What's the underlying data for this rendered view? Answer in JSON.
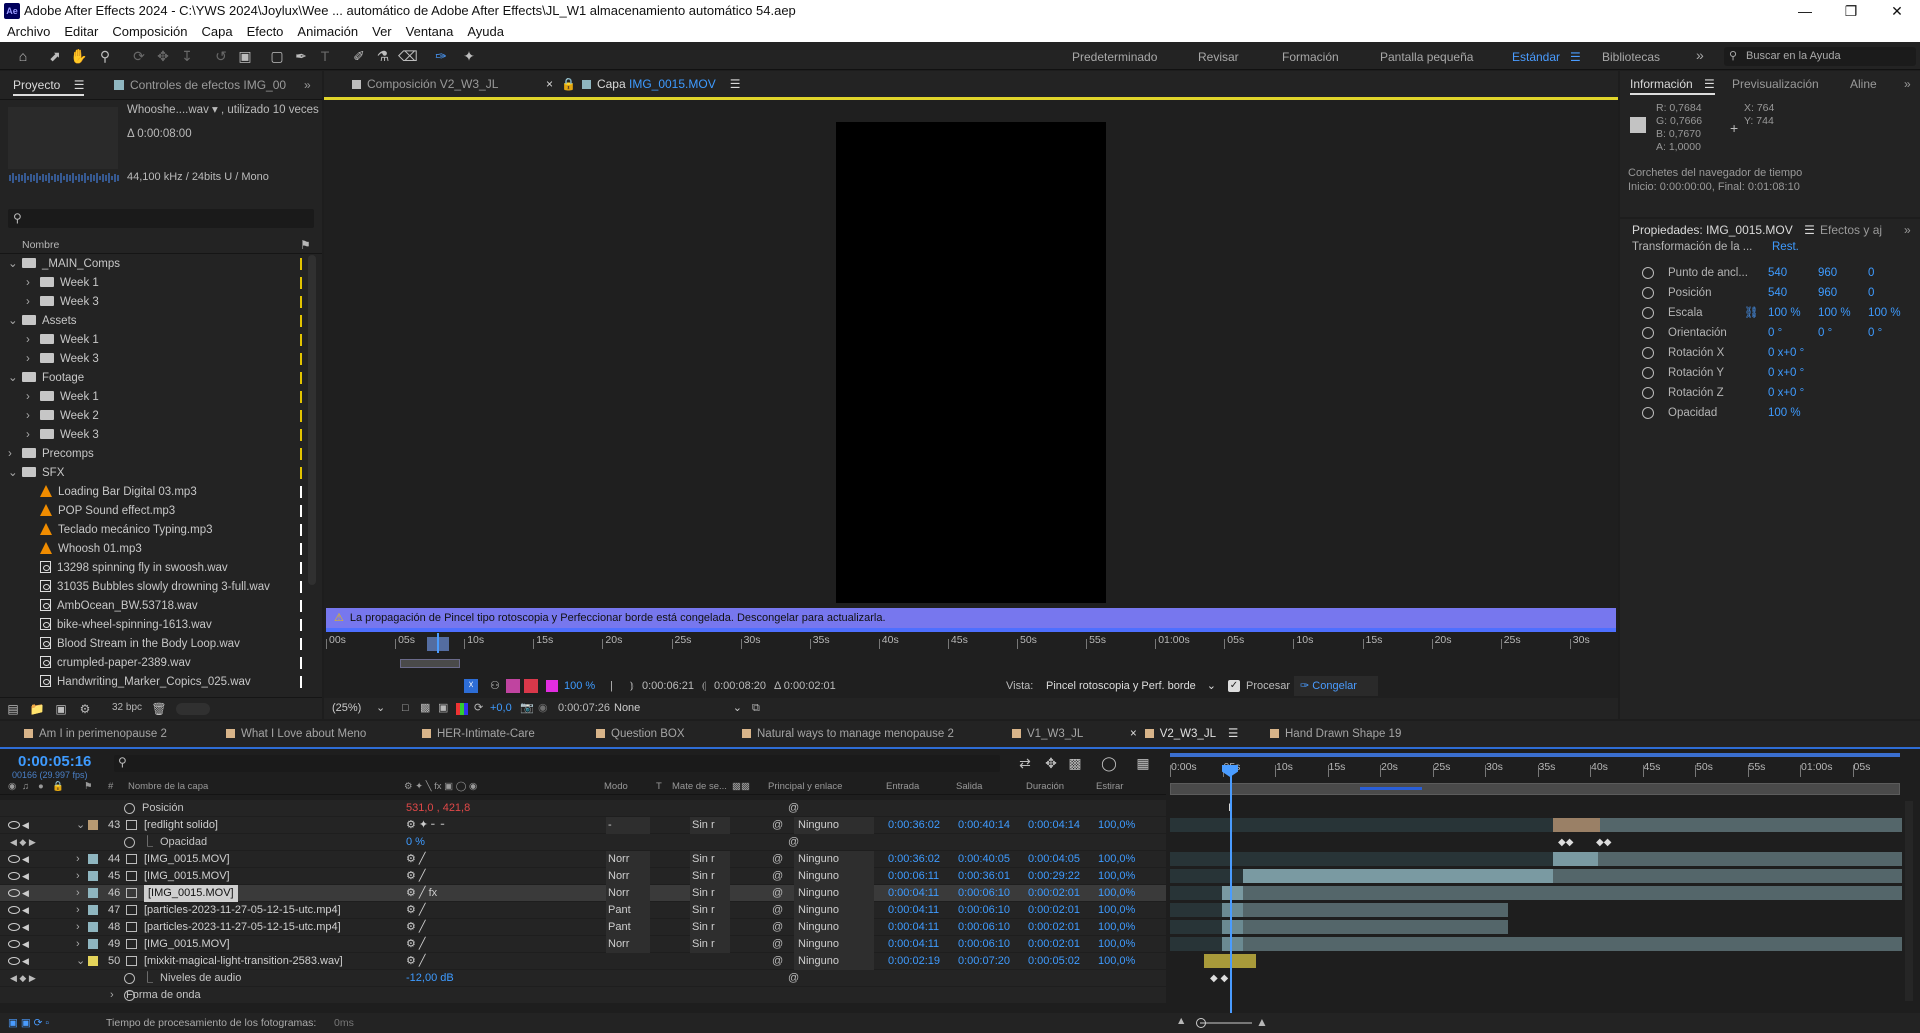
{
  "app": {
    "title": "Adobe After Effects 2024 - C:\\YWS 2024\\Joylux\\Wee ... automático de Adobe After Effects\\JL_W1 almacenamiento automático 54.aep",
    "icon": "Ae"
  },
  "menu": [
    "Archivo",
    "Editar",
    "Composición",
    "Capa",
    "Efecto",
    "Animación",
    "Ver",
    "Ventana",
    "Ayuda"
  ],
  "workspaces": [
    "Predeterminado",
    "Revisar",
    "Formación",
    "Pantalla pequeña",
    "Estándar",
    "Bibliotecas"
  ],
  "workspace_active": "Estándar",
  "help_search": "Buscar en la Ayuda",
  "project": {
    "tab": "Proyecto",
    "tab2": "Controles de efectos IMG_00",
    "selected_item": "Whooshe....wav ▾ , utilizado 10 veces",
    "duration": "Δ 0:00:08:00",
    "audio_info": "44,100 kHz / 24bits U / Mono",
    "col_name": "Nombre",
    "bpc": "32 bpc",
    "items": [
      {
        "level": 0,
        "type": "folder",
        "open": true,
        "label": "_MAIN_Comps"
      },
      {
        "level": 1,
        "type": "folder",
        "open": false,
        "label": "Week 1"
      },
      {
        "level": 1,
        "type": "folder",
        "open": false,
        "label": "Week 3"
      },
      {
        "level": 0,
        "type": "folder",
        "open": true,
        "label": "Assets"
      },
      {
        "level": 1,
        "type": "folder",
        "open": false,
        "label": "Week 1"
      },
      {
        "level": 1,
        "type": "folder",
        "open": false,
        "label": "Week 3"
      },
      {
        "level": 0,
        "type": "folder",
        "open": true,
        "label": "Footage"
      },
      {
        "level": 1,
        "type": "folder",
        "open": false,
        "label": "Week 1"
      },
      {
        "level": 1,
        "type": "folder",
        "open": false,
        "label": "Week 2"
      },
      {
        "level": 1,
        "type": "folder",
        "open": false,
        "label": "Week 3"
      },
      {
        "level": 0,
        "type": "folder",
        "open": false,
        "label": "Precomps"
      },
      {
        "level": 0,
        "type": "folder",
        "open": true,
        "label": "SFX"
      },
      {
        "level": 1,
        "type": "mp3",
        "label": "Loading Bar Digital 03.mp3"
      },
      {
        "level": 1,
        "type": "mp3",
        "label": "POP Sound effect.mp3"
      },
      {
        "level": 1,
        "type": "mp3",
        "label": "Teclado mecánico Typing.mp3"
      },
      {
        "level": 1,
        "type": "mp3",
        "label": "Whoosh 01.mp3"
      },
      {
        "level": 1,
        "type": "wav",
        "label": "13298 spinning fly in swoosh.wav"
      },
      {
        "level": 1,
        "type": "wav",
        "label": "31035 Bubbles slowly drowning 3-full.wav"
      },
      {
        "level": 1,
        "type": "wav",
        "label": "AmbOcean_BW.53718.wav"
      },
      {
        "level": 1,
        "type": "wav",
        "label": "bike-wheel-spinning-1613.wav"
      },
      {
        "level": 1,
        "type": "wav",
        "label": "Blood Stream in the Body Loop.wav"
      },
      {
        "level": 1,
        "type": "wav",
        "label": "crumpled-paper-2389.wav"
      },
      {
        "level": 1,
        "type": "wav",
        "label": "Handwriting_Marker_Copics_025.wav"
      }
    ]
  },
  "viewer": {
    "tab1": "Composición V2_W3_JL",
    "tab2": "Capa",
    "tab2_name": "IMG_0015.MOV",
    "warning": "La propagación de Pincel tipo rotoscopia y Perfeccionar borde está congelada. Descongelar para actualizarla.",
    "ruler": [
      "00s",
      "05s",
      "10s",
      "15s",
      "20s",
      "25s",
      "30s",
      "35s",
      "40s",
      "45s",
      "50s",
      "55s",
      "01:00s",
      "05s",
      "10s",
      "15s",
      "20s",
      "25s",
      "30s"
    ],
    "zoom_pct": "100 %",
    "in_time": "0:00:06:21",
    "out_time": "0:00:08:20",
    "dur_time": "Δ 0:00:02:01",
    "view_label": "Vista:",
    "view_value": "Pincel rotoscopia y Perf. borde",
    "process": "Procesar",
    "freeze": "Congelar",
    "zoom": "(25%)",
    "exposure": "+0,0",
    "current_time": "0:00:07:26",
    "channel": "None"
  },
  "info": {
    "tab": "Información",
    "tab2": "Previsualización",
    "tab3": "Aline",
    "r": "R: 0,7684",
    "g": "G: 0,7666",
    "b": "B: 0,7670",
    "a": "A: 1,0000",
    "x": "X: 764",
    "y": "Y: 744",
    "line1": "Corchetes del navegador de tiempo",
    "line2": "Inicio: 0:00:00:00, Final: 0:01:08:10"
  },
  "properties": {
    "tab": "Propiedades: IMG_0015.MOV",
    "tab2": "Efectos y aj",
    "section": "Transformación de la ...",
    "reset": "Rest.",
    "rows": [
      {
        "label": "Punto de ancl...",
        "v1": "540",
        "v2": "960",
        "v3": "0"
      },
      {
        "label": "Posición",
        "v1": "540",
        "v2": "960",
        "v3": "0"
      },
      {
        "label": "Escala",
        "v1": "100 %",
        "v2": "100 %",
        "v3": "100 %"
      },
      {
        "label": "Orientación",
        "v1": "0 °",
        "v2": "0 °",
        "v3": "0 °"
      },
      {
        "label": "Rotación X",
        "v1": "0 x+0 °",
        "v2": "",
        "v3": ""
      },
      {
        "label": "Rotación Y",
        "v1": "0 x+0 °",
        "v2": "",
        "v3": ""
      },
      {
        "label": "Rotación Z",
        "v1": "0 x+0 °",
        "v2": "",
        "v3": ""
      },
      {
        "label": "Opacidad",
        "v1": "100 %",
        "v2": "",
        "v3": ""
      }
    ]
  },
  "timeline": {
    "comp_tabs": [
      "Am I in perimenopause 2",
      "What I Love about Meno",
      "HER-Intimate-Care",
      "Question BOX",
      "Natural ways to manage menopause 2",
      "V1_W3_JL",
      "V2_W3_JL",
      "Hand Drawn Shape 19"
    ],
    "active_tab": "V2_W3_JL",
    "timecode": "0:00:05:16",
    "frames": "00166 (29.997 fps)",
    "cols": {
      "name": "Nombre de la capa",
      "mode": "Modo",
      "t": "T",
      "matte": "Mate de se...",
      "parent": "Principal y enlace",
      "in": "Entrada",
      "out": "Salida",
      "dur": "Duración",
      "stretch": "Estirar"
    },
    "ruler": [
      "0:00s",
      "05s",
      "10s",
      "15s",
      "20s",
      "25s",
      "30s",
      "35s",
      "40s",
      "45s",
      "50s",
      "55s",
      "01:00s",
      "05s"
    ],
    "rows": [
      {
        "kind": "prop",
        "label": "Posición",
        "value": "531,0 , 421,8"
      },
      {
        "kind": "layer",
        "num": "43",
        "name": "[redlight solido]",
        "color": "#b89a72",
        "mode": "-",
        "matte": "Sin r",
        "parent": "Ninguno",
        "in": "0:00:36:02",
        "out": "0:00:40:14",
        "dur": "0:00:04:14",
        "stretch": "100,0%"
      },
      {
        "kind": "prop",
        "label": "Opacidad",
        "value": "0 %"
      },
      {
        "kind": "layer",
        "num": "44",
        "name": "[IMG_0015.MOV]",
        "color": "#8fb6c0",
        "mode": "Norr",
        "matte": "Sin r",
        "parent": "Ninguno",
        "in": "0:00:36:02",
        "out": "0:00:40:05",
        "dur": "0:00:04:05",
        "stretch": "100,0%"
      },
      {
        "kind": "layer",
        "num": "45",
        "name": "[IMG_0015.MOV]",
        "color": "#8fb6c0",
        "mode": "Norr",
        "matte": "Sin r",
        "parent": "Ninguno",
        "in": "0:00:06:11",
        "out": "0:00:36:01",
        "dur": "0:00:29:22",
        "stretch": "100,0%"
      },
      {
        "kind": "layer",
        "num": "46",
        "name": "[IMG_0015.MOV]",
        "color": "#8fb6c0",
        "mode": "Norr",
        "matte": "Sin r",
        "parent": "Ninguno",
        "in": "0:00:04:11",
        "out": "0:00:06:10",
        "dur": "0:00:02:01",
        "stretch": "100,0%",
        "selected": true
      },
      {
        "kind": "layer",
        "num": "47",
        "name": "[particles-2023-11-27-05-12-15-utc.mp4]",
        "color": "#8fb6c0",
        "mode": "Pant",
        "matte": "Sin r",
        "parent": "Ninguno",
        "in": "0:00:04:11",
        "out": "0:00:06:10",
        "dur": "0:00:02:01",
        "stretch": "100,0%"
      },
      {
        "kind": "layer",
        "num": "48",
        "name": "[particles-2023-11-27-05-12-15-utc.mp4]",
        "color": "#8fb6c0",
        "mode": "Pant",
        "matte": "Sin r",
        "parent": "Ninguno",
        "in": "0:00:04:11",
        "out": "0:00:06:10",
        "dur": "0:00:02:01",
        "stretch": "100,0%"
      },
      {
        "kind": "layer",
        "num": "49",
        "name": "[IMG_0015.MOV]",
        "color": "#8fb6c0",
        "mode": "Norr",
        "matte": "Sin r",
        "parent": "Ninguno",
        "in": "0:00:04:11",
        "out": "0:00:06:10",
        "dur": "0:00:02:01",
        "stretch": "100,0%"
      },
      {
        "kind": "layer",
        "num": "50",
        "name": "[mixkit-magical-light-transition-2583.wav]",
        "color": "#e3d35a",
        "mode": "",
        "matte": "",
        "parent": "Ninguno",
        "in": "0:00:02:19",
        "out": "0:00:07:20",
        "dur": "0:00:05:02",
        "stretch": "100,0%"
      },
      {
        "kind": "prop",
        "label": "Niveles de audio",
        "value": "-12,00 dB"
      },
      {
        "kind": "group",
        "label": "Forma de onda",
        "value": ""
      }
    ],
    "status": "Tiempo de procesamiento de los fotogramas:",
    "status_value": "0ms"
  }
}
